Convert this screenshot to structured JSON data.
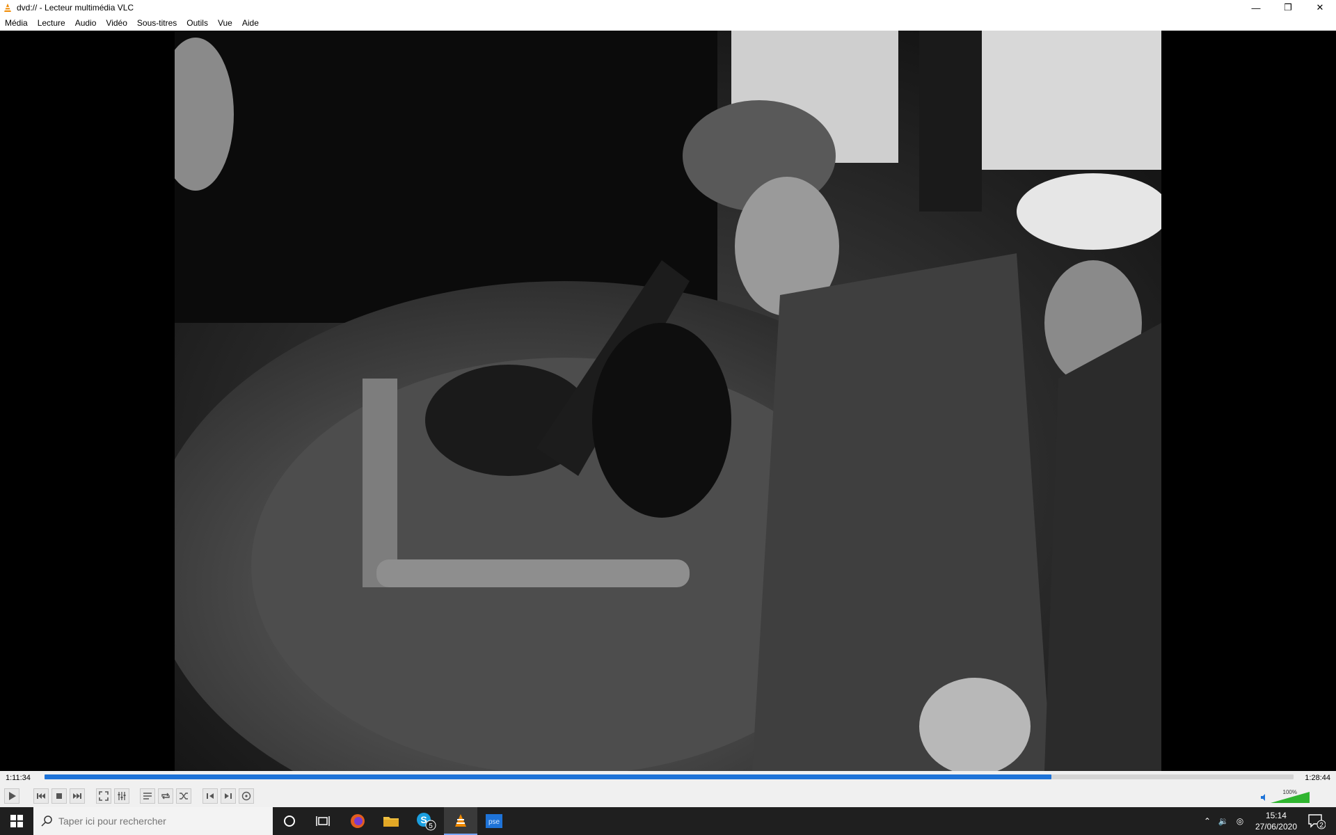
{
  "window": {
    "title": "dvd:// - Lecteur multimédia VLC"
  },
  "menu": [
    "Média",
    "Lecture",
    "Audio",
    "Vidéo",
    "Sous-titres",
    "Outils",
    "Vue",
    "Aide"
  ],
  "playback": {
    "elapsed": "1:11:34",
    "total": "1:28:44",
    "progress_fraction": 0.806,
    "volume_label": "100%",
    "volume_fraction": 1.0
  },
  "controls": {
    "buttons": [
      "play-icon",
      "previous-icon",
      "stop-icon",
      "next-icon",
      "fullscreen-icon",
      "extended-settings-icon",
      "playlist-icon",
      "loop-icon",
      "shuffle-icon",
      "frame-back-icon",
      "frame-forward-icon",
      "dvd-menu-icon"
    ]
  },
  "taskbar": {
    "search_placeholder": "Taper ici pour rechercher",
    "skype_badge": "5",
    "ps_label": "pse",
    "time": "15:14",
    "date": "27/06/2020",
    "notifications": "2"
  },
  "colors": {
    "accent": "#1e73d8",
    "taskbar": "#1f1f1f"
  }
}
